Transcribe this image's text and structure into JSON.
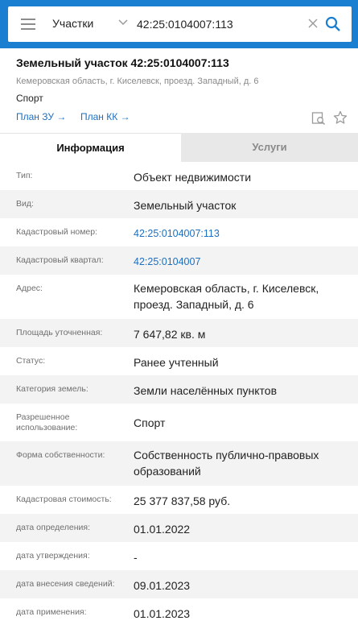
{
  "search": {
    "layer": "Участки",
    "query": "42:25:0104007:113"
  },
  "header": {
    "title": "Земельный участок 42:25:0104007:113",
    "address": "Кемеровская область, г. Киселевск, проезд. Западный, д. 6",
    "usage": "Спорт",
    "link_zu": "План ЗУ →",
    "link_kk": "План КК →"
  },
  "tabs": {
    "info": "Информация",
    "services": "Услуги"
  },
  "rows": [
    {
      "label": "Тип:",
      "value": "Объект недвижимости"
    },
    {
      "label": "Вид:",
      "value": "Земельный участок"
    },
    {
      "label": "Кадастровый номер:",
      "value": "42:25:0104007:113"
    },
    {
      "label": "Кадастровый квартал:",
      "value": "42:25:0104007"
    },
    {
      "label": "Адрес:",
      "value": "Кемеровская область, г. Киселевск, проезд. Западный, д. 6"
    },
    {
      "label": "Площадь уточненная:",
      "value": "7 647,82 кв. м"
    },
    {
      "label": "Статус:",
      "value": "Ранее учтенный"
    },
    {
      "label": "Категория земель:",
      "value": "Земли населённых пунктов"
    },
    {
      "label": "Разрешенное использование:",
      "value": "Спорт"
    },
    {
      "label": "Форма собственности:",
      "value": "Собственность публично-правовых образований"
    },
    {
      "label": "Кадастровая стоимость:",
      "value": "25 377 837,58 руб."
    },
    {
      "label": "дата определения:",
      "value": "01.01.2022"
    },
    {
      "label": "дата утверждения:",
      "value": "-"
    },
    {
      "label": "дата внесения сведений:",
      "value": "09.01.2023"
    },
    {
      "label": "дата применения:",
      "value": "01.01.2023"
    }
  ]
}
